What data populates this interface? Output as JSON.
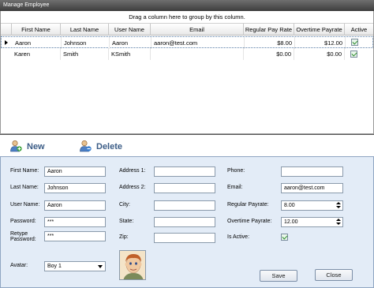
{
  "window": {
    "title": "Manage Employee"
  },
  "grid": {
    "group_hint": "Drag a column here to group by this column.",
    "columns": [
      "First Name",
      "Last Name",
      "User Name",
      "Email",
      "Regular Pay Rate",
      "Overtime Payrate",
      "Active"
    ],
    "rows": [
      {
        "first_name": "Aaron",
        "last_name": "Johnson",
        "user_name": "Aaron",
        "email": "aaron@test.com",
        "regular_pay_rate": "$8.00",
        "overtime_payrate": "$12.00",
        "active": true,
        "selected": true
      },
      {
        "first_name": "Karen",
        "last_name": "Smith",
        "user_name": "KSmith",
        "email": "",
        "regular_pay_rate": "$0.00",
        "overtime_payrate": "$0.00",
        "active": true,
        "selected": false
      }
    ]
  },
  "toolbar": {
    "new_label": "New",
    "delete_label": "Delete"
  },
  "form": {
    "first_name_label": "First Name:",
    "first_name_value": "Aaron",
    "last_name_label": "Last Name:",
    "last_name_value": "Johnson",
    "user_name_label": "User Name:",
    "user_name_value": "Aaron",
    "password_label": "Password:",
    "password_value": "***",
    "retype_password_label_1": "Retype",
    "retype_password_label_2": "Password:",
    "retype_password_value": "***",
    "address1_label": "Address 1:",
    "address1_value": "",
    "address2_label": "Address 2:",
    "address2_value": "",
    "city_label": "City:",
    "city_value": "",
    "state_label": "State:",
    "state_value": "",
    "zip_label": "Zip:",
    "zip_value": "",
    "phone_label": "Phone:",
    "phone_value": "",
    "email_label": "Email:",
    "email_value": "aaron@test.com",
    "regular_payrate_label": "Regular Payrate:",
    "regular_payrate_value": "8.00",
    "overtime_payrate_label": "Overtime Payrate:",
    "overtime_payrate_value": "12.00",
    "is_active_label": "Is Active:",
    "is_active": true,
    "avatar_label": "Avatar:",
    "avatar_value": "Boy 1",
    "save_label": "Save",
    "close_label": "Close"
  },
  "colors": {
    "accent": "#3b5c86",
    "form_bg": "#e3ecf7",
    "title_bg": "#4a4a4a"
  }
}
